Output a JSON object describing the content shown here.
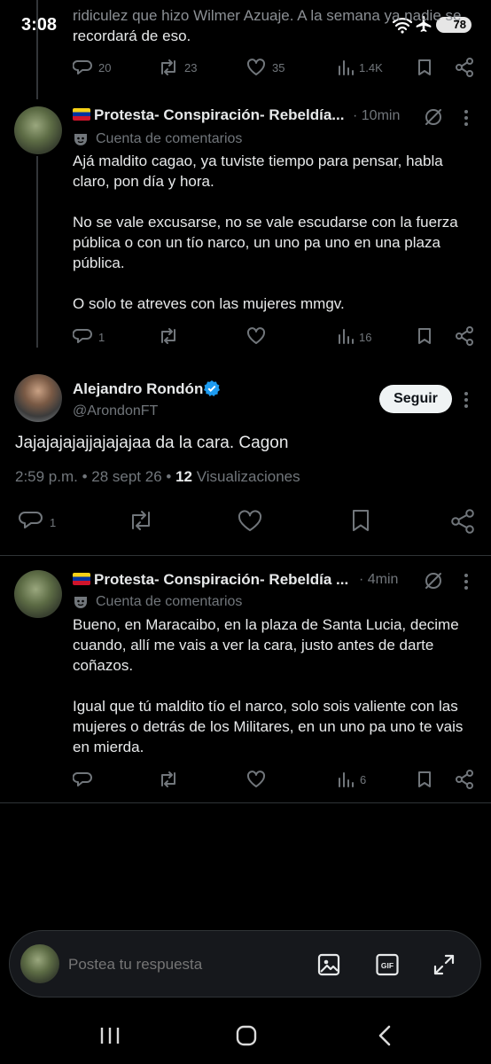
{
  "status_bar": {
    "time": "3:08",
    "battery": "78"
  },
  "post1": {
    "text_line1": "ridiculez que hizo Wilmer Azuaje. A la semana ya nadie se",
    "text_line2": "recordará de eso.",
    "replies": "20",
    "reposts": "23",
    "likes": "35",
    "views": "1.4K"
  },
  "post2": {
    "author": "Protesta- Conspiración- Rebeldía...",
    "time": "· 10min",
    "account_type": "Cuenta de comentarios",
    "text_p1": "Ajá maldito cagao, ya tuviste tiempo para pensar, habla claro, pon día y hora.",
    "text_p2": "No se vale excusarse, no se vale escudarse con la fuerza pública o con un tío narco, un uno pa uno en una plaza pública.",
    "text_p3": "O solo te atreves con las mujeres mmgv.",
    "replies": "1",
    "views": "16"
  },
  "main_post": {
    "author": "Alejandro Rondón",
    "handle": "@ArondonFT",
    "follow_label": "Seguir",
    "text": "Jajajajajajjajajajaa da la cara. Cagon",
    "timestamp": "2:59 p.m. • 28 sept 26 •",
    "views_count": "12",
    "views_label": "Visualizaciones",
    "replies": "1"
  },
  "post3": {
    "author": "Protesta- Conspiración- Rebeldía ...",
    "time": "· 4min",
    "account_type": "Cuenta de comentarios",
    "text_p1": "Bueno, en Maracaibo, en la plaza de Santa Lucia, decime cuando, allí me vais a ver la cara, justo antes de darte coñazos.",
    "text_p2": "Igual que tú maldito tío el narco, solo sois valiente con las mujeres o detrás de los Militares, en un uno pa uno te vais en mierda.",
    "views": "6"
  },
  "compose": {
    "placeholder": "Postea tu respuesta"
  },
  "icons": [
    "reply-icon",
    "repost-icon",
    "like-icon",
    "views-icon",
    "bookmark-icon",
    "share-icon",
    "grok-icon",
    "more-icon",
    "image-icon",
    "gif-icon",
    "expand-icon",
    "verified-badge-icon",
    "comment-account-icon"
  ],
  "colors": {
    "background": "#000000",
    "text": "#e7e9ea",
    "muted": "#71767b",
    "verified": "#1d9bf0",
    "divider": "#2f3336"
  }
}
